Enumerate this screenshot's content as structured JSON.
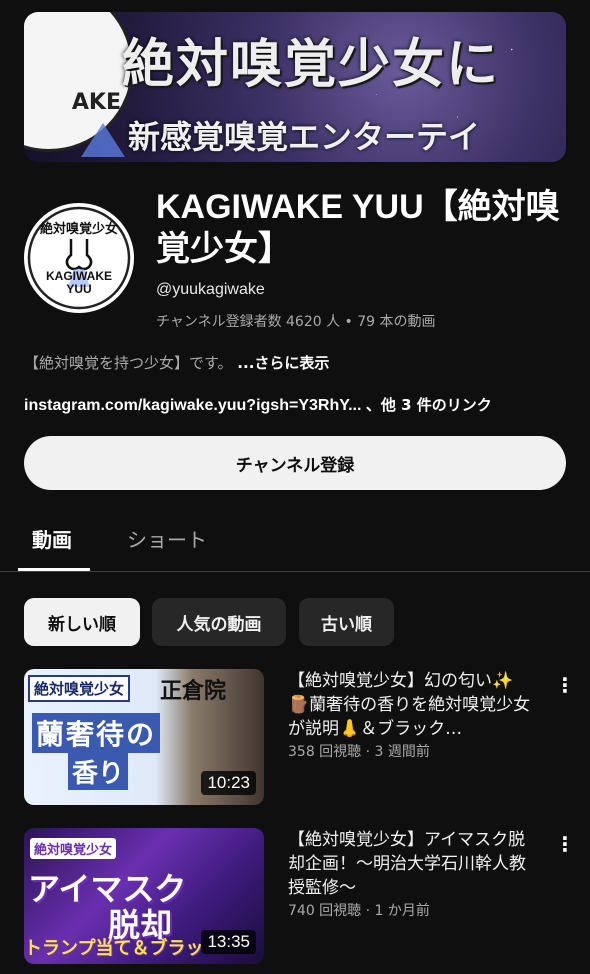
{
  "banner": {
    "title": "絶対嗅覚少女に",
    "subtitle": "新感覚嗅覚エンターテイ",
    "logo_text": "AKE",
    "colors": {
      "bg": "#2a2150"
    }
  },
  "channel": {
    "avatar_top_text": "絶対嗅覚少女",
    "avatar_mid_text": "KAGIWAKE",
    "avatar_bot_text": "YUU",
    "name": "KAGIWAKE YUU【絶対嗅覚少女】",
    "handle": "@yuukagiwake",
    "stats": "チャンネル登録者数 4620 人 • 79 本の動画",
    "description": "【絶対嗅覚を持つ少女】です。",
    "more_label": "...さらに表示",
    "link": "instagram.com/kagiwake.yuu?igsh=Y3RhY...",
    "other_links": "、他 3 件のリンク",
    "subscribe_label": "チャンネル登録"
  },
  "tabs": [
    {
      "label": "動画",
      "active": true
    },
    {
      "label": "ショート",
      "active": false
    }
  ],
  "chips": [
    {
      "label": "新しい順",
      "selected": true
    },
    {
      "label": "人気の動画",
      "selected": false
    },
    {
      "label": "古い順",
      "selected": false
    }
  ],
  "videos": [
    {
      "title": "【絶対嗅覚少女】幻の匂い✨ 🪵蘭奢待の香りを絶対嗅覚少女が説明👃＆ブラック…",
      "meta": "358 回視聴 · 3 週間前",
      "duration": "10:23",
      "thumb": {
        "tag": "絶対嗅覚少女",
        "line1": "蘭奢待の",
        "line2": "香り",
        "right": "正倉院"
      }
    },
    {
      "title": "【絶対嗅覚少女】アイマスク脱却企画！～明治大学石川幹人教授監修～",
      "meta": "740 回視聴 · 1 か月前",
      "duration": "13:35",
      "thumb": {
        "tag": "絶対嗅覚少女",
        "line1": "アイマスク",
        "line2": "脱却",
        "bar": "トランプ当て＆ブラッ"
      }
    }
  ],
  "icons": {
    "menu": "kebab-menu-icon"
  }
}
